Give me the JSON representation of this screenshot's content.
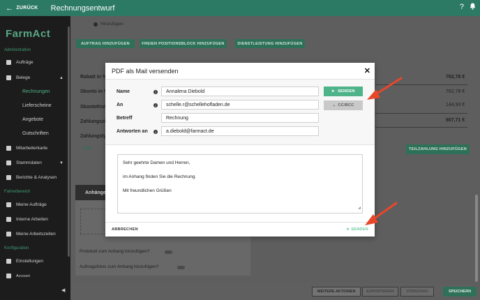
{
  "topbar": {
    "back_label": "ZURÜCK",
    "title": "Rechnungsentwurf",
    "help": "?",
    "bell": "🔔"
  },
  "sidebar": {
    "logo": "FarmAct",
    "sections": {
      "admin": "Administration",
      "fahrer": "Fahrerbereich",
      "konfig": "Konfiguration"
    },
    "items": [
      {
        "label": "Aufträge"
      },
      {
        "label": "Belege"
      },
      {
        "label": "Mitarbeiterkarte"
      },
      {
        "label": "Stammdaten"
      },
      {
        "label": "Berichte & Analysen"
      },
      {
        "label": "Meine Aufträge"
      },
      {
        "label": "Interne Arbeiten"
      },
      {
        "label": "Meine Arbeitszeiten"
      },
      {
        "label": "Einstellungen"
      },
      {
        "label": "Account"
      }
    ],
    "sub": [
      "Rechnungen",
      "Lieferscheine",
      "Angebote",
      "Gutschriften"
    ],
    "collapse": "◀"
  },
  "main": {
    "add_link": "Hinzufügen",
    "btn_auftrag": "AUFTRAG HINZUFÜGEN",
    "btn_block": "FREIEN POSITIONSBLOCK HINZUFÜGEN",
    "btn_dienst": "DIENSTLEISTUNG HINZUFÜGEN",
    "rabatt": "Rabatt in %",
    "skonto": "Skonto in %",
    "skontofrist": "Skontofrist",
    "zahlungsziel": "Zahlungsziel",
    "zahlungstyp": "Zahlungstyp",
    "offen": "Offen",
    "amounts": [
      "762,78 €",
      "762,78 €",
      "144,93 €",
      "907,71 €"
    ],
    "teilzahlung": "TEILZAHLUNG HINZUFÜGEN",
    "anhaenge": "Anhänge",
    "protokoll": "Protokoll zum Anhang hinzufügen?",
    "fotos": "Auftragsfotos zum Anhang hinzufügen?",
    "footer": {
      "weitere": "WEITERE AKTIONEN",
      "exportieren": "EXPORTIEREN",
      "vorschau": "VORSCHAU",
      "speichern": "SPEICHERN"
    }
  },
  "modal": {
    "title": "PDF als Mail versenden",
    "close": "✕",
    "fields": {
      "name_label": "Name",
      "name_value": "Annalena Diebold",
      "an_label": "An",
      "an_value": "schelle.r@schellehofladen.de",
      "betreff_label": "Betreff",
      "betreff_value": "Rechnung",
      "antworten_label": "Antworten an",
      "antworten_value": "a.diebold@farmact.de"
    },
    "send_label": "SENDEN",
    "cc_label": "CC/BCC",
    "message": {
      "greeting": "Sehr geehrte Damen und Herren,",
      "body": "im Anhang finden Sie die Rechnung.",
      "closing": "Mit freundlichen Grüßen"
    },
    "cancel_label": "ABBRECHEN",
    "send_footer_label": "SENDEN"
  },
  "colors": {
    "accent": "#4fb38a",
    "topbar": "#2c7a63",
    "annotation": "#e8472b"
  }
}
